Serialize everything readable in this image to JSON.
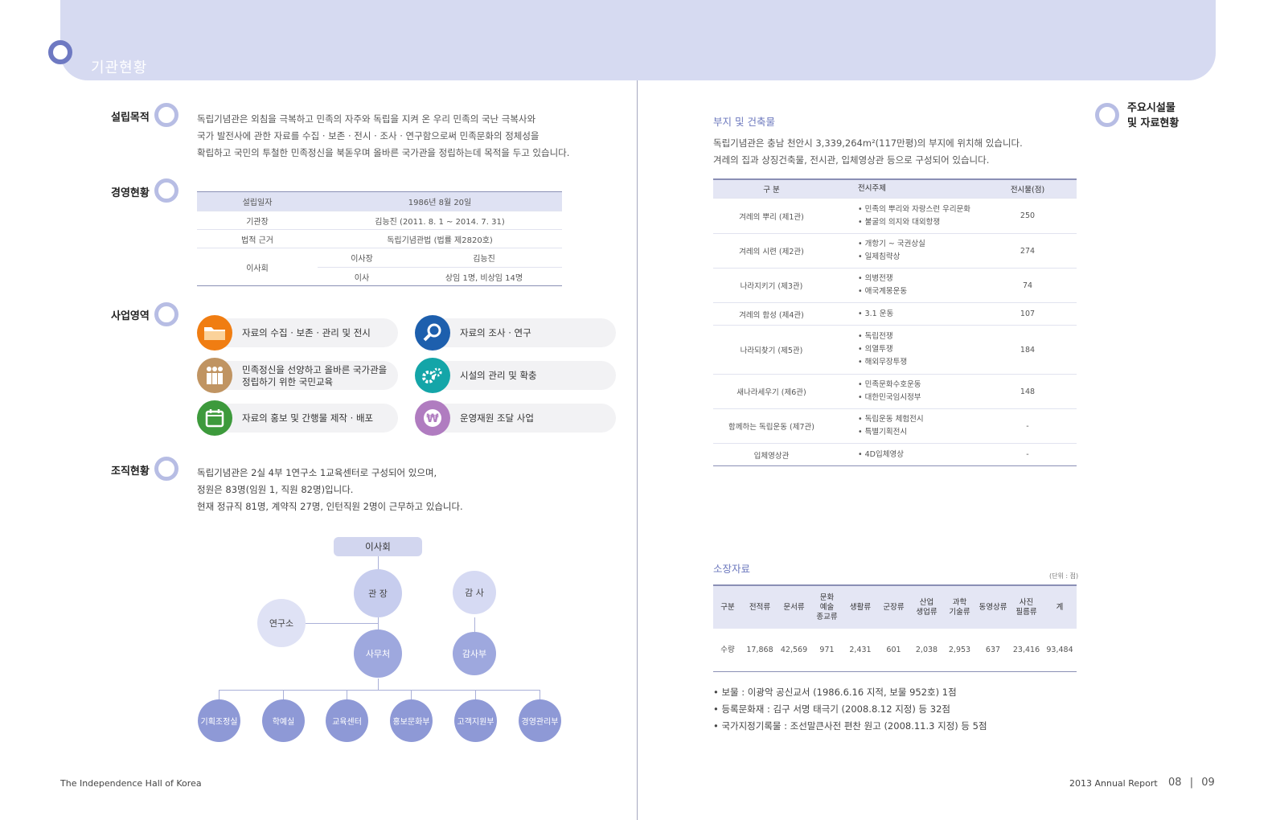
{
  "header": {
    "title": "기관현황"
  },
  "left": {
    "purpose": {
      "label": "설립목적",
      "lines": [
        "독립기념관은 외침을 극복하고 민족의 자주와 독립을 지켜 온 우리 민족의 국난 극복사와",
        "국가 발전사에 관한 자료를 수집 · 보존 · 전시 · 조사 · 연구함으로써 민족문화의 정체성을",
        "확립하고 국민의 투철한 민족정신을 북돋우며 올바른 국가관을 정립하는데 목적을 두고 있습니다."
      ]
    },
    "management": {
      "label": "경영현황",
      "rows": [
        {
          "k": "설립일자",
          "v": "1986년 8월 20일"
        },
        {
          "k": "기관장",
          "v": "김능진 (2011. 8. 1 ~ 2014. 7. 31)"
        },
        {
          "k": "법적 근거",
          "v": "독립기념관법 (법률 제2820호)"
        }
      ],
      "board": {
        "k": "이사회",
        "sub": [
          {
            "k": "이사장",
            "v": "김능진"
          },
          {
            "k": "이사",
            "v": "상임 1명, 비상임 14명"
          }
        ]
      }
    },
    "business": {
      "label": "사업영역",
      "items": [
        {
          "line1": "자료의 수집 · 보존 · 관리 및 전시",
          "line2": ""
        },
        {
          "line1": "자료의 조사 · 연구",
          "line2": ""
        },
        {
          "line1": "민족정신을 선양하고 올바른 국가관을",
          "line2": "정립하기 위한 국민교육"
        },
        {
          "line1": "시설의 관리 및 확충",
          "line2": ""
        },
        {
          "line1": "자료의 홍보 및 간행물 제작 · 배포",
          "line2": ""
        },
        {
          "line1": "운영재원 조달 사업",
          "line2": ""
        }
      ],
      "icons": [
        "folder-icon",
        "magnifier-icon",
        "people-icon",
        "gears-icon",
        "calendar-icon",
        "won-icon"
      ],
      "colors": [
        "#f07d12",
        "#1d5fad",
        "#c09462",
        "#14a5a8",
        "#3d9a3c",
        "#b07cc0"
      ]
    },
    "organization": {
      "label": "조직현황",
      "lines": [
        "독립기념관은 2실 4부 1연구소 1교육센터로 구성되어 있으며,",
        "정원은 83명(임원 1, 직원 82명)입니다.",
        "현재 정규직 81명, 계약직 27명, 인턴직원 2명이 근무하고 있습니다."
      ],
      "chart": {
        "board": "이사회",
        "director": "관 장",
        "auditor": "감 사",
        "institute": "연구소",
        "secretariat": "사무처",
        "audit_dept": "감사부",
        "depts": [
          "기획조정실",
          "학예실",
          "교육센터",
          "홍보문화부",
          "고객지원부",
          "경영관리부"
        ]
      }
    }
  },
  "right": {
    "side_label_line1": "주요시설물",
    "side_label_line2": "및 자료현황",
    "site": {
      "title": "부지 및 건축물",
      "line1": "독립기념관은 충남 천안시 3,339,264m²(117만평)의 부지에 위치해 있습니다.",
      "line2": "겨레의 집과 상징건축물, 전시관, 입체영상관 등으로 구성되어 있습니다."
    },
    "facility_table": {
      "headers": [
        "구 분",
        "전시주제",
        "전시물(점)"
      ],
      "rows": [
        {
          "name": "겨레의 뿌리 (제1관)",
          "topics": [
            "• 민족의 뿌리와 자랑스런 우리문화",
            "• 불굴의 의지와 대외항쟁"
          ],
          "count": "250"
        },
        {
          "name": "겨레의 시련 (제2관)",
          "topics": [
            "• 개항기 ~ 국권상실",
            "• 일제침략상"
          ],
          "count": "274"
        },
        {
          "name": "나라지키기 (제3관)",
          "topics": [
            "• 의병전쟁",
            "• 애국계몽운동"
          ],
          "count": "74"
        },
        {
          "name": "겨레의 함성 (제4관)",
          "topics": [
            "• 3.1 운동"
          ],
          "count": "107"
        },
        {
          "name": "나라되찾기 (제5관)",
          "topics": [
            "• 독립전쟁",
            "• 의열투쟁",
            "• 해외무장투쟁"
          ],
          "count": "184"
        },
        {
          "name": "새나라세우기 (제6관)",
          "topics": [
            "• 민족문화수호운동",
            "• 대한민국임시정부"
          ],
          "count": "148"
        },
        {
          "name": "함께하는 독립운동 (제7관)",
          "topics": [
            "• 독립운동 체험전시",
            "• 특별기획전시"
          ],
          "count": "-"
        },
        {
          "name": "입체영상관",
          "topics": [
            "• 4D입체영상"
          ],
          "count": "-"
        }
      ]
    },
    "holdings": {
      "title": "소장자료",
      "unit": "(단위 : 점)",
      "headers": [
        "구분",
        "전적류",
        "문서류",
        "문화\n예술\n종교류",
        "생활류",
        "군장류",
        "산업\n생업류",
        "과학\n기술류",
        "동영상류",
        "사진\n필름류",
        "계"
      ],
      "values": [
        "수량",
        "17,868",
        "42,569",
        "971",
        "2,431",
        "601",
        "2,038",
        "2,953",
        "637",
        "23,416",
        "93,484"
      ]
    },
    "notes": [
      "• 보물 : 이광악 공신교서 (1986.6.16 지적, 보물 952호) 1점",
      "• 등록문화재 : 김구 서명 태극기 (2008.8.12 지정) 등 32점",
      "• 국가지정기록물 : 조선말큰사전 편찬 원고 (2008.11.3 지정) 등 5점"
    ]
  },
  "footer": {
    "left": "The Independence Hall of Korea",
    "right": "2013 Annual Report",
    "page_left": "08",
    "page_sep": "|",
    "page_right": "09"
  }
}
